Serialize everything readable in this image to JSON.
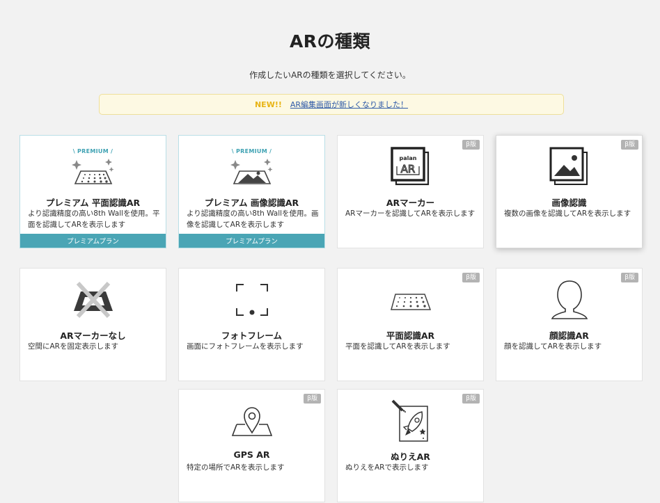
{
  "header": {
    "title": "ARの種類",
    "subtitle": "作成したいARの種類を選択してください。"
  },
  "notice": {
    "badge": "NEW!!",
    "link_text": "AR編集画面が新しくなりました！"
  },
  "cards": [
    {
      "title": "プレミアム 平面認識AR",
      "desc": "より認識精度の高い8th Wallを使用。平面を認識してARを表示します",
      "premium_label": "\\ PREMIUM /",
      "plan": "プレミアムプラン",
      "icon": "premium-plane-icon"
    },
    {
      "title": "プレミアム 画像認識AR",
      "desc": "より認識精度の高い8th Wallを使用。画像を認識してARを表示します",
      "premium_label": "\\ PREMIUM /",
      "plan": "プレミアムプラン",
      "icon": "premium-image-icon"
    },
    {
      "title": "ARマーカー",
      "desc": "ARマーカーを認識してARを表示します",
      "beta": "β版",
      "icon": "ar-marker-icon",
      "marker_text": "palan"
    },
    {
      "title": "画像認識",
      "desc": "複数の画像を認識してARを表示します",
      "beta": "β版",
      "icon": "image-recognition-icon"
    },
    {
      "title": "ARマーカーなし",
      "desc": "空間にARを固定表示します",
      "icon": "no-marker-icon"
    },
    {
      "title": "フォトフレーム",
      "desc": "画面にフォトフレームを表示します",
      "icon": "photo-frame-icon"
    },
    {
      "title": "平面認識AR",
      "desc": "平面を認識してARを表示します",
      "beta": "β版",
      "icon": "plane-recognition-icon"
    },
    {
      "title": "顔認識AR",
      "desc": "顔を認識してARを表示します",
      "beta": "β版",
      "icon": "face-recognition-icon"
    },
    {
      "title": "GPS AR",
      "desc": "特定の場所でARを表示します",
      "beta": "β版",
      "icon": "gps-pin-icon"
    },
    {
      "title": "ぬりえAR",
      "desc": "ぬりえをARで表示します",
      "beta": "β版",
      "icon": "coloring-rocket-icon"
    }
  ],
  "colors": {
    "accent": "#4aa5b5",
    "new_badge": "#e8b416",
    "beta_badge": "#b3b3b3",
    "link": "#2e5aa8"
  }
}
